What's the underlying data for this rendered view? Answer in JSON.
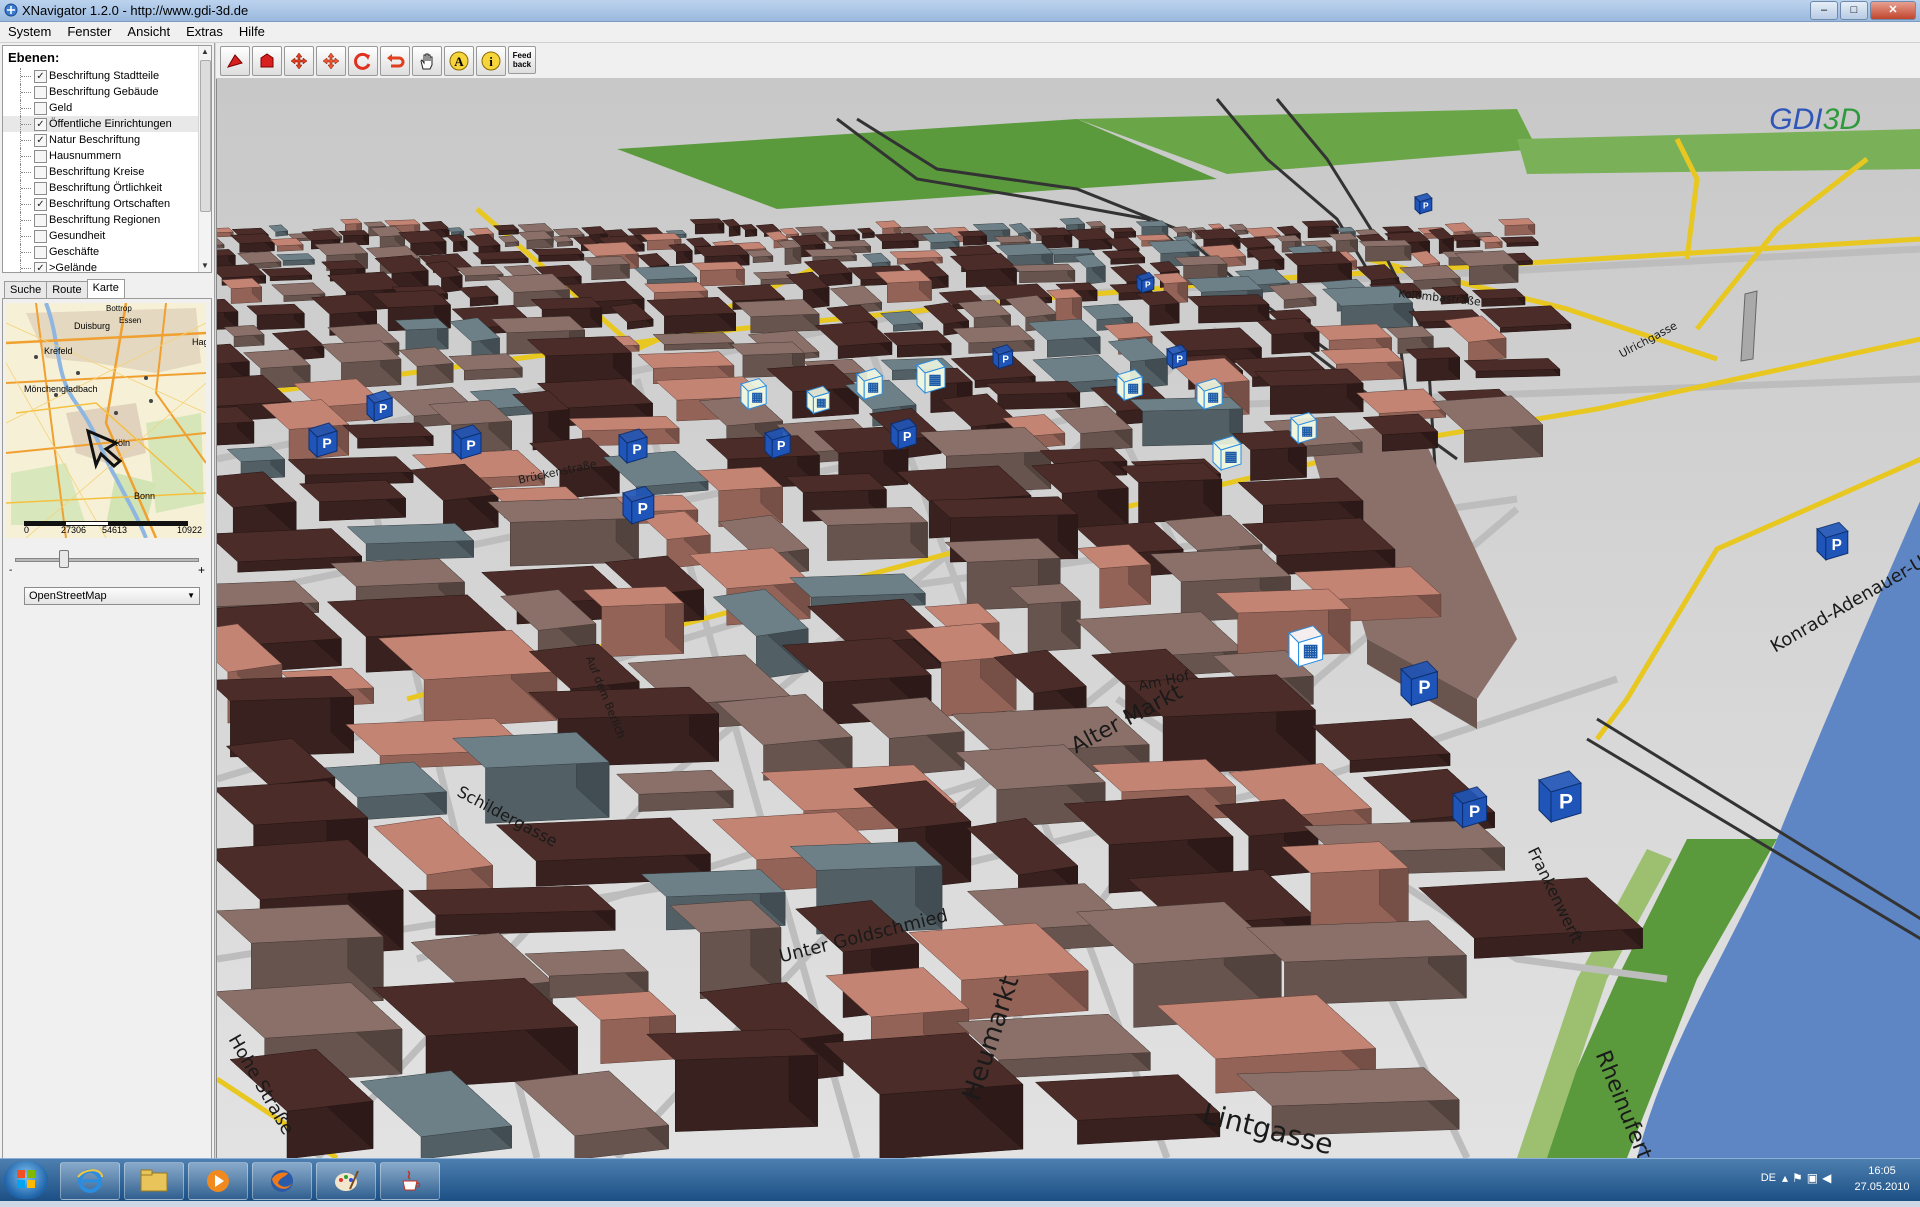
{
  "window": {
    "title": "XNavigator 1.2.0 - http://www.gdi-3d.de",
    "minimize": "–",
    "maximize": "□",
    "close": "✕"
  },
  "menu": [
    "System",
    "Fenster",
    "Ansicht",
    "Extras",
    "Hilfe"
  ],
  "layers": {
    "title": "Ebenen:",
    "items": [
      {
        "label": "Beschriftung Stadtteile",
        "checked": true
      },
      {
        "label": "Beschriftung Gebäude",
        "checked": false
      },
      {
        "label": "Geld",
        "checked": false
      },
      {
        "label": "Öffentliche Einrichtungen",
        "checked": true,
        "selected": true
      },
      {
        "label": "Natur Beschriftung",
        "checked": true
      },
      {
        "label": "Hausnummern",
        "checked": false
      },
      {
        "label": "Beschriftung Kreise",
        "checked": false
      },
      {
        "label": "Beschriftung Örtlichkeit",
        "checked": false
      },
      {
        "label": "Beschriftung Ortschaften",
        "checked": true
      },
      {
        "label": "Beschriftung Regionen",
        "checked": false
      },
      {
        "label": "Gesundheit",
        "checked": false
      },
      {
        "label": "Geschäfte",
        "checked": false
      },
      {
        "label": ">Gelände",
        "checked": true
      }
    ]
  },
  "tabs": [
    {
      "label": "Suche",
      "active": false
    },
    {
      "label": "Route",
      "active": false
    },
    {
      "label": "Karte",
      "active": true
    }
  ],
  "overview_map": {
    "cities": [
      "Bottrop",
      "Essen",
      "Duisburg",
      "Krefeld",
      "Mönchengladbach",
      "Köln",
      "Bonn",
      "Hagen"
    ],
    "scale": [
      "0",
      "27306",
      "54613",
      "10922"
    ]
  },
  "zoom_slider": {
    "minus": "-",
    "plus": "+",
    "level": 0.24
  },
  "map_source": {
    "selected": "OpenStreetMap"
  },
  "toolbar": {
    "buttons": [
      "tilt-icon",
      "rotate-up-icon",
      "pan-icon",
      "move-icon",
      "rotate-icon",
      "undo-icon",
      "hand-icon",
      "text-icon",
      "info-icon",
      "feedback-icon"
    ],
    "text_label": "A",
    "info_label": "i",
    "feedback_label": "Feed back"
  },
  "map3d": {
    "logo": {
      "gdi": "GDI",
      "threed": "3D"
    },
    "street_labels": [
      "Alter Markt",
      "Schildergasse",
      "Lintgasse",
      "Heumarkt",
      "Rheinufertunnel",
      "Frankenwerft",
      "Konrad-Adenauer-Ufer",
      "Hohe Straße",
      "Unter Goldschmied",
      "Am Hof",
      "Brückenstraße",
      "Kolumbastraße",
      "Auf dem Berlich",
      "Ulrichgasse"
    ],
    "colors": {
      "ground": "#d8d8d8",
      "street": "#bdbdbd",
      "main_road": "#e8c820",
      "building_dark": "#4b2c28",
      "building_brown": "#8a7068",
      "building_salmon": "#c48474",
      "building_slate": "#6d8088",
      "park": "#5b9a3c",
      "rhine": "#5f86c4",
      "parking_blue": "#1f55b8"
    }
  },
  "taskbar": {
    "apps": [
      "ie-icon",
      "explorer-icon",
      "media-player-icon",
      "firefox-icon",
      "paint-icon",
      "java-icon"
    ],
    "language": "DE",
    "time": "16:05",
    "date": "27.05.2010"
  }
}
